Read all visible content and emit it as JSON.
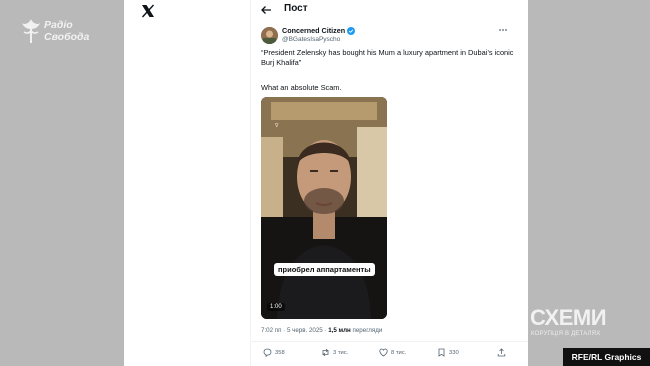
{
  "brand": {
    "logo_line1": "Радіо",
    "logo_line2": "Свобода"
  },
  "header": {
    "title": "Пост"
  },
  "author": {
    "name": "Concerned Citizen",
    "handle": "@BGatesIsaPyscho"
  },
  "tweet": {
    "text": "“President Zelensky has bought his Mum a luxury apartment in Dubai’s iconic Burj Khalifa”",
    "text2": "What an absolute Scam."
  },
  "video": {
    "caption": "приобрел аппартаменты",
    "duration": "1:00"
  },
  "meta": {
    "time": "7:02 пп · 5 черв. 2025 · ",
    "views": "1,5 млн",
    "views_label": " перегляди"
  },
  "actions": {
    "replies": "358",
    "reposts": "3 тис.",
    "likes": "8 тис.",
    "bookmarks": "330"
  },
  "watermark": {
    "title": "СХЕМИ",
    "subtitle": "КОРУПЦІЯ В ДЕТАЛЯХ"
  },
  "credit": "RFE/RL Graphics",
  "colors": {
    "background": "#b9b9b9",
    "verified": "#1d9bf0"
  },
  "icons": [
    "radio-svoboda-logo-icon",
    "x-logo-icon",
    "back-arrow-icon",
    "verified-badge-icon",
    "more-icon",
    "reply-icon",
    "repost-icon",
    "like-icon",
    "bookmark-icon",
    "share-icon"
  ]
}
